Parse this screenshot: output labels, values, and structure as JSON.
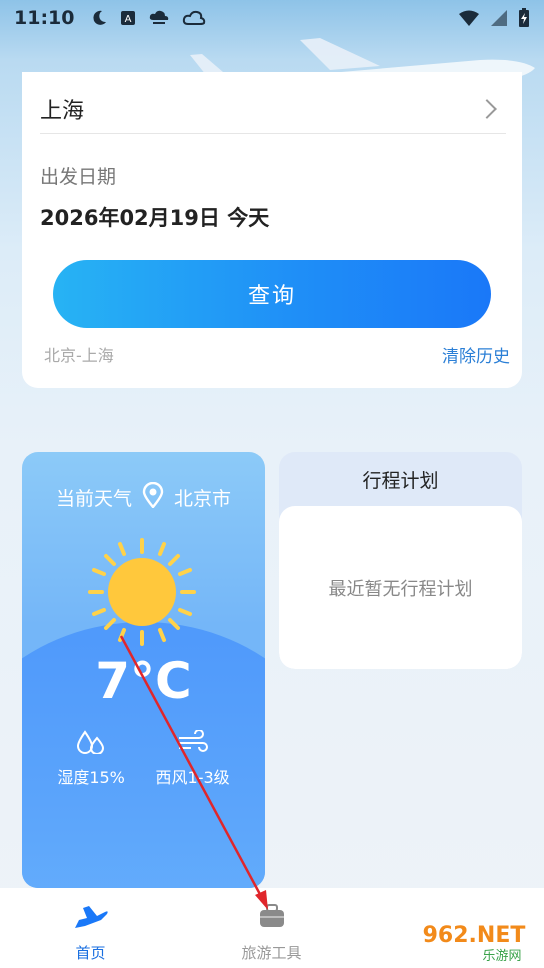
{
  "status_bar": {
    "time": "11:10",
    "left_icons": [
      "moon-icon",
      "a-badge-icon",
      "cloud-rain-icon",
      "cloud-icon"
    ],
    "right_icons": [
      "wifi-icon",
      "signal-icon",
      "battery-icon"
    ]
  },
  "search": {
    "arrival_city": "上海",
    "date_label": "出发日期",
    "date_value": "2026年02月19日 今天",
    "query_button": "查询",
    "history_item": "北京-上海",
    "clear_history": "清除历史"
  },
  "weather": {
    "header_label": "当前天气",
    "city": "北京市",
    "temperature": "7°C",
    "humidity": "湿度15%",
    "wind": "西风1-3级",
    "icon": "sun-icon"
  },
  "trip": {
    "title": "行程计划",
    "empty_text": "最近暂无行程计划"
  },
  "nav": {
    "items": [
      {
        "label": "首页",
        "icon": "plane-icon",
        "active": true
      },
      {
        "label": "旅游工具",
        "icon": "luggage-icon",
        "active": false
      }
    ]
  },
  "watermark": {
    "text": "962.NET",
    "subtext": "乐游网"
  },
  "colors": {
    "primary": "#1a78f8",
    "link": "#2b7fd6",
    "annotation": "#e0262b"
  }
}
